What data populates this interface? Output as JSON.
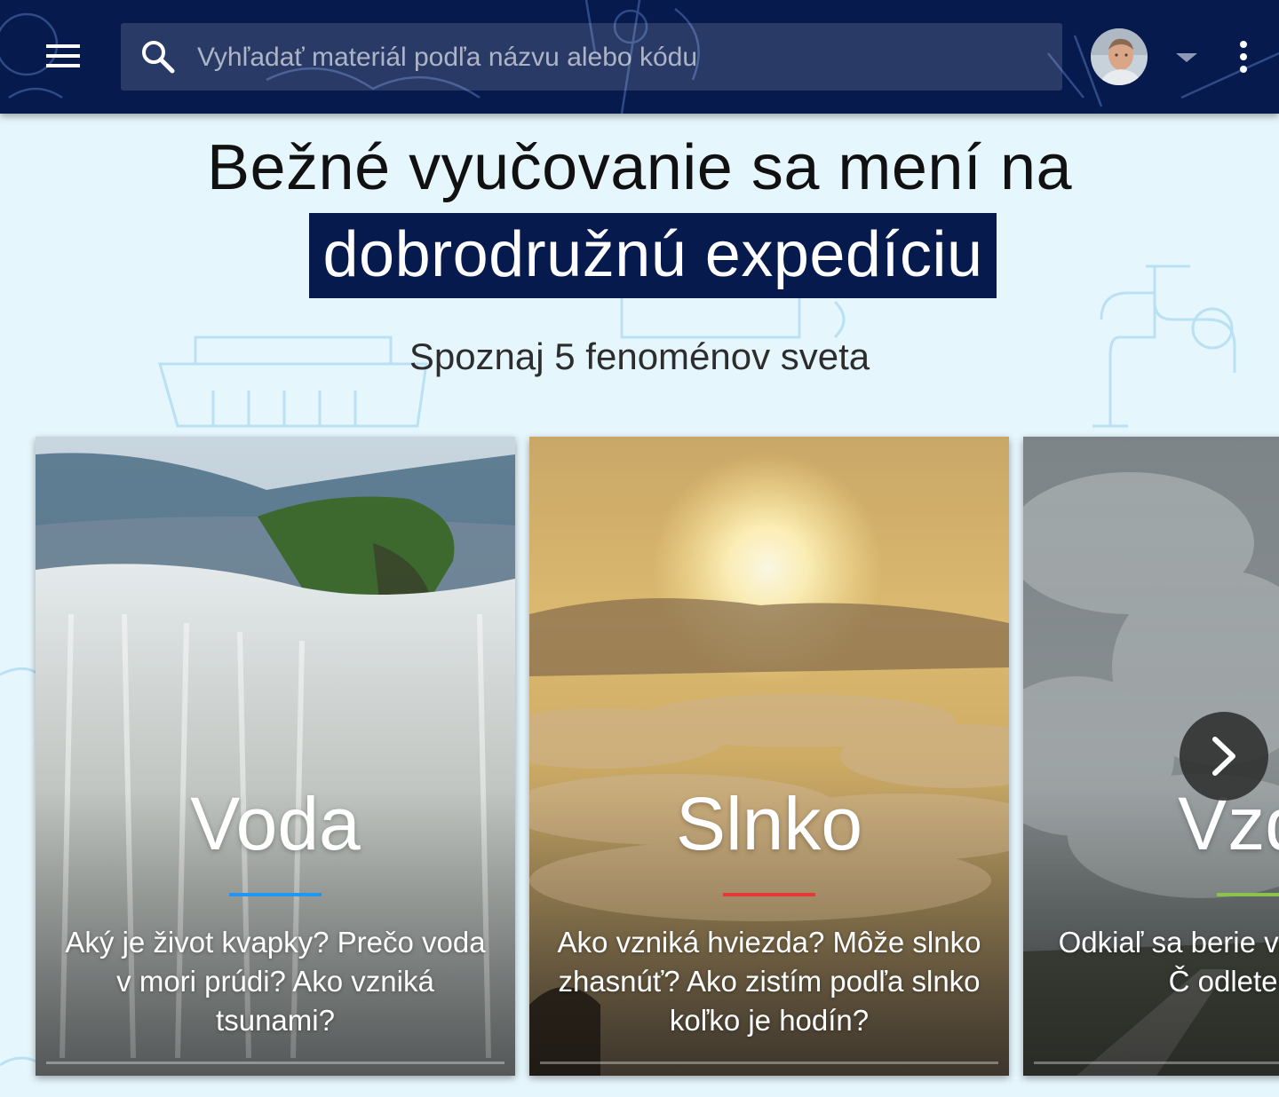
{
  "header": {
    "search_placeholder": "Vyhľadať materiál podľa názvu alebo kódu",
    "menu_icon": "hamburger-menu-icon",
    "search_icon": "search-icon",
    "more_icon": "more-vert-icon",
    "avatar_caret_icon": "caret-down-icon",
    "background_color": "#061a4e"
  },
  "hero": {
    "line1": "Bežné vyučovanie sa mení na",
    "line2": "dobrodružnú expedíciu",
    "subtitle": "Spoznaj 5 fenoménov sveta",
    "highlight_color": "#061a4e"
  },
  "cards": [
    {
      "title": "Voda",
      "description": "Aký je život kvapky? Prečo voda v mori prúdi? Ako vzniká tsunami?",
      "accent_color": "#2196f3"
    },
    {
      "title": "Slnko",
      "description": "Ako vzniká hviezda? Môže slnko zhasnúť? Ako zistím podľa slnko koľko je hodín?",
      "accent_color": "#e53935"
    },
    {
      "title": "Vzdu",
      "description": "Odkiaľ sa berie vi nám vzduch? Č odleteným b",
      "accent_color": "#8bc34a"
    }
  ],
  "carousel": {
    "next_icon": "chevron-right-icon"
  },
  "page_background": "#e6f6fd"
}
